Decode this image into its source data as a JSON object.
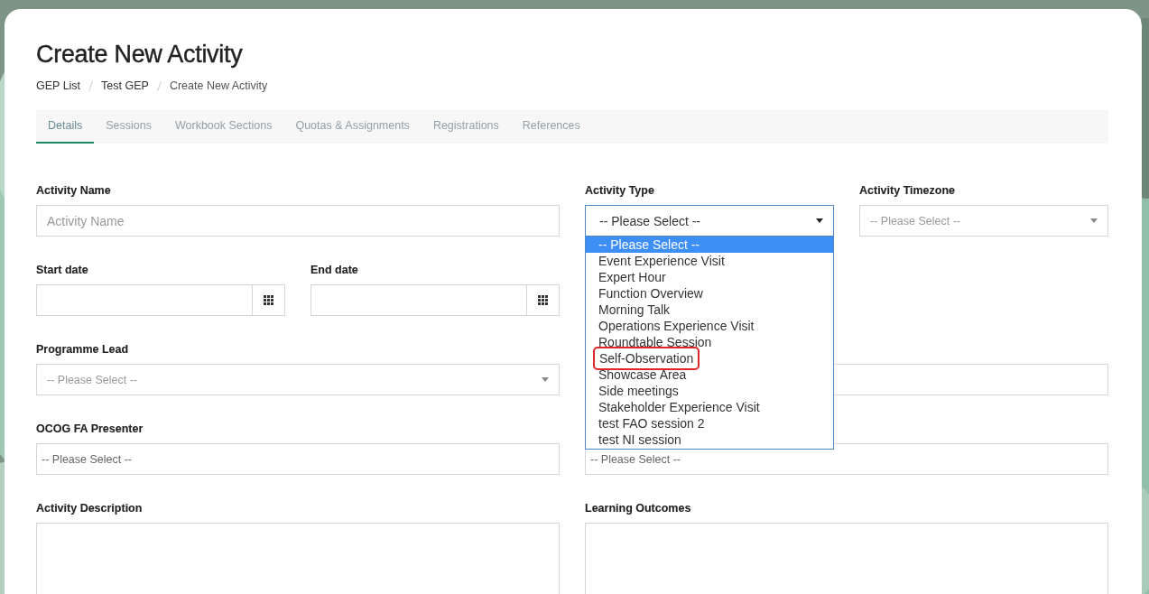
{
  "page": {
    "title": "Create New Activity"
  },
  "breadcrumb": [
    {
      "label": "GEP List"
    },
    {
      "label": "Test GEP"
    },
    {
      "label": "Create New Activity"
    }
  ],
  "tabs": [
    {
      "label": "Details",
      "selected": true
    },
    {
      "label": "Sessions",
      "selected": false
    },
    {
      "label": "Workbook Sections",
      "selected": false
    },
    {
      "label": "Quotas & Assignments",
      "selected": false
    },
    {
      "label": "Registrations",
      "selected": false
    },
    {
      "label": "References",
      "selected": false
    }
  ],
  "fields": [
    {
      "kind": "text",
      "label": "Activity Name",
      "placeholder": "Activity Name"
    },
    {
      "kind": "dropdown-open",
      "label": "Activity Type",
      "value": "-- Please Select --",
      "options": [
        {
          "label": "-- Please Select --",
          "selected": true,
          "highlighted": false
        },
        {
          "label": "Event Experience Visit",
          "selected": false,
          "highlighted": false
        },
        {
          "label": "Expert Hour",
          "selected": false,
          "highlighted": false
        },
        {
          "label": "Function Overview",
          "selected": false,
          "highlighted": false
        },
        {
          "label": "Morning Talk",
          "selected": false,
          "highlighted": false
        },
        {
          "label": "Operations Experience Visit",
          "selected": false,
          "highlighted": false
        },
        {
          "label": "Roundtable Session",
          "selected": false,
          "highlighted": false
        },
        {
          "label": "Self-Observation",
          "selected": false,
          "highlighted": true
        },
        {
          "label": "Showcase Area",
          "selected": false,
          "highlighted": false
        },
        {
          "label": "Side meetings",
          "selected": false,
          "highlighted": false
        },
        {
          "label": "Stakeholder Experience Visit",
          "selected": false,
          "highlighted": false
        },
        {
          "label": "test FAO session 2",
          "selected": false,
          "highlighted": false
        },
        {
          "label": "test NI session",
          "selected": false,
          "highlighted": false
        }
      ]
    },
    {
      "kind": "select",
      "label": "Activity Timezone",
      "placeholder": "-- Please Select --"
    },
    {
      "kind": "date",
      "label": "Start date"
    },
    {
      "kind": "date",
      "label": "End date"
    },
    {
      "kind": "select",
      "label": "Programme Lead",
      "placeholder": "-- Please Select --"
    },
    {
      "kind": "text"
    },
    {
      "kind": "plain-select",
      "label": "OCOG FA Presenter",
      "placeholder": "-- Please Select --"
    },
    {
      "kind": "plain-select",
      "placeholder": "-- Please Select --"
    },
    {
      "kind": "textarea",
      "label": "Activity Description"
    },
    {
      "kind": "textarea",
      "label": "Learning Outcomes"
    }
  ]
}
